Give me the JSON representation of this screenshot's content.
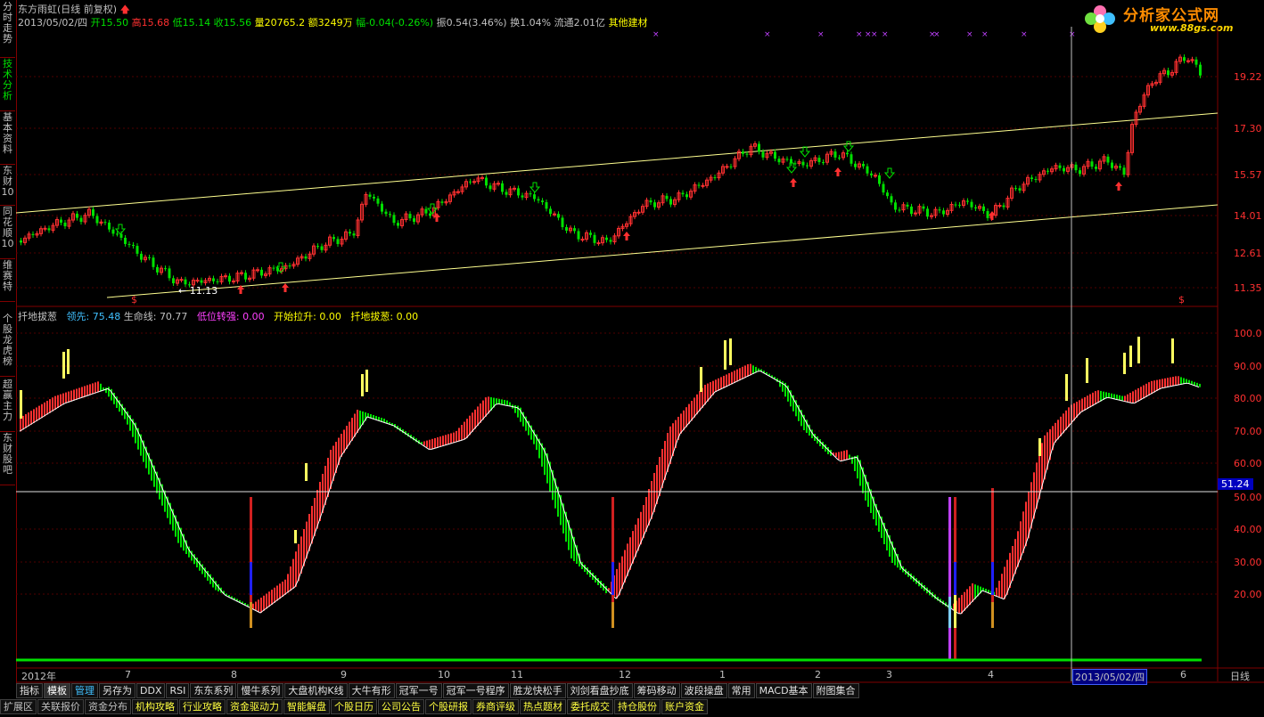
{
  "left_tabs": [
    {
      "label": "分时走势"
    },
    {
      "label": "技术分析"
    },
    {
      "label": "基本资料"
    },
    {
      "label": "东财10"
    },
    {
      "label": "同花顺10"
    },
    {
      "label": "维赛特"
    },
    {
      "label": "个股龙虎榜"
    },
    {
      "label": "超赢主力"
    },
    {
      "label": "东财股吧"
    }
  ],
  "header": {
    "stock_name": "东方雨虹",
    "chart_mode": "(日线 前复权)",
    "date": "2013/05/02/四",
    "open_label": "开",
    "open": "15.50",
    "high_label": "高",
    "high": "15.68",
    "low_label": "低",
    "low": "15.14",
    "close_label": "收",
    "close": "15.56",
    "volume_label": "量",
    "volume": "20765.2",
    "amount_label": "额",
    "amount": "3249万",
    "change_label": "幅",
    "change": "-0.04(-0.26%)",
    "amplitude_label": "振",
    "amplitude": "0.54(3.46%)",
    "turnover_label": "换",
    "turnover": "1.04%",
    "float_label": "流通",
    "float": "2.01亿",
    "sector": "其他建材"
  },
  "logo": {
    "text": "分析家公式网",
    "url": "www.88gs.com"
  },
  "price_axis": [
    "19.22",
    "17.30",
    "15.57",
    "14.01",
    "12.61",
    "11.35"
  ],
  "min_price_label": "11.13",
  "indicator": {
    "name": "扦地拔葱",
    "lead_label": "领先:",
    "lead": "75.48",
    "life_label": "生命线:",
    "life": "70.77",
    "low_label": "低位转强:",
    "low": "0.00",
    "start_label": "开始拉升:",
    "start": "0.00",
    "pull_label": "扦地拔葱:",
    "pull": "0.00",
    "axis": [
      "100.0",
      "90.00",
      "80.00",
      "70.00",
      "60.00",
      "50.00",
      "40.00",
      "30.00",
      "20.00"
    ],
    "current": "51.24"
  },
  "time_axis": {
    "ticks": [
      "2012年",
      "7",
      "8",
      "9",
      "10",
      "11",
      "12",
      "1",
      "2",
      "3",
      "4",
      "5",
      "6"
    ],
    "cursor_date": "2013/05/02/四",
    "period": "日线"
  },
  "toolbar_1": [
    "指标",
    "模板",
    "管理",
    "另存为",
    "DDX",
    "RSI",
    "东东系列",
    "慢牛系列",
    "大盘机构K线",
    "大牛有形",
    "冠军一号",
    "冠军一号程序",
    "胜龙快松手",
    "刘剑看盘抄底",
    "筹码移动",
    "波段操盘",
    "常用",
    "MACD基本",
    "附图集合"
  ],
  "toolbar_2": [
    "扩展区",
    "关联报价",
    "资金分布",
    "机构攻略",
    "行业攻略",
    "资金驱动力",
    "智能解盘",
    "个股日历",
    "公司公告",
    "个股研报",
    "券商评级",
    "热点题材",
    "委托成交",
    "持仓股份",
    "账户资金"
  ],
  "colors": {
    "up": "#ff3030",
    "down": "#00e000",
    "channel": "#ffff80",
    "background": "#000000"
  }
}
